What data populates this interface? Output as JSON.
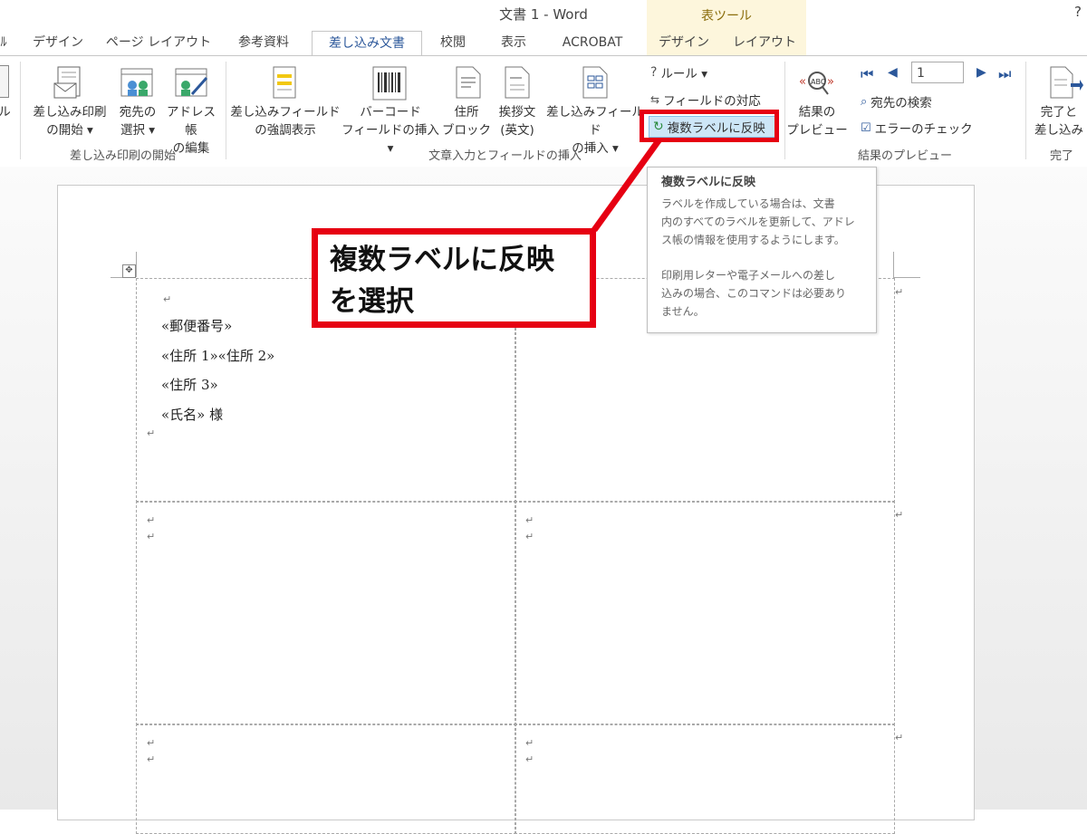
{
  "window": {
    "title": "文書 1 - Word",
    "help": "?"
  },
  "context_tools": {
    "label": "表ツール"
  },
  "tabs": [
    {
      "label": "ﾙ"
    },
    {
      "label": "デザイン"
    },
    {
      "label": "ページ レイアウト"
    },
    {
      "label": "参考資料"
    },
    {
      "label": "差し込み文書"
    },
    {
      "label": "校閲"
    },
    {
      "label": "表示"
    },
    {
      "label": "ACROBAT"
    },
    {
      "label": "デザイン"
    },
    {
      "label": "レイアウト"
    }
  ],
  "ribbon": {
    "left_cut": "ル",
    "start_merge": {
      "btn1": {
        "line1": "差し込み印刷",
        "line2": "の開始 ▾"
      },
      "btn2": {
        "line1": "宛先の",
        "line2": "選択 ▾"
      },
      "btn3": {
        "line1": "アドレス帳",
        "line2": "の編集"
      },
      "group": "差し込み印刷の開始"
    },
    "write_insert": {
      "btn1": {
        "line1": "差し込みフィールド",
        "line2": "の強調表示"
      },
      "btn2": {
        "line1": "バーコード",
        "line2": "フィールドの挿入 ▾"
      },
      "btn3": {
        "line1": "住所",
        "line2": "ブロック"
      },
      "btn4": {
        "line1": "挨拶文",
        "line2": "(英文)"
      },
      "btn5": {
        "line1": "差し込みフィールド",
        "line2": "の挿入 ▾"
      },
      "rules": "ルール ▾",
      "match_fields": "フィールドの対応",
      "update_labels": "複数ラベルに反映",
      "group": "文章入力とフィールドの挿入"
    },
    "preview": {
      "btn1": {
        "line1": "結果の",
        "line2": "プレビュー"
      },
      "record": "1",
      "find_recipient": "宛先の検索",
      "check_errors": "エラーのチェック",
      "group": "結果のプレビュー"
    },
    "finish": {
      "btn1": {
        "line1": "完了と",
        "line2": "差し込み"
      },
      "group": "完了"
    }
  },
  "tooltip": {
    "title": "複数ラベルに反映",
    "lines": [
      "ラベルを作成している場合は、文書",
      "内のすべてのラベルを更新して、アドレ",
      "ス帳の情報を使用するようにします。",
      "",
      "印刷用レターや電子メールへの差し",
      "込みの場合、このコマンドは必要あり",
      "ません。"
    ]
  },
  "callout": {
    "line1": "複数ラベルに反映",
    "line2": "を選択"
  },
  "document": {
    "label_fields": [
      "«郵便番号»",
      "«住所 1»«住所 2»",
      "«住所 3»",
      "«氏名» 様"
    ],
    "para_mark": "↵"
  },
  "colors": {
    "accent": "#2b579a",
    "highlight": "#e60012",
    "context_band": "#fdf6dc"
  }
}
